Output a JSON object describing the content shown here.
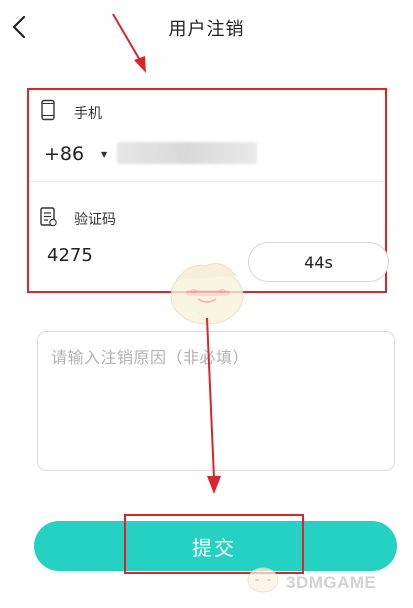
{
  "header": {
    "title": "用户注销",
    "back_icon": "chevron-left-icon"
  },
  "form": {
    "phone": {
      "icon": "phone-icon",
      "label": "手机",
      "country_code": "+86",
      "dropdown_icon": "caret-down-icon",
      "number_masked": true
    },
    "code": {
      "icon": "document-icon",
      "label": "验证码",
      "value": "4275",
      "countdown": "44s"
    }
  },
  "reason": {
    "placeholder": "请输入注销原因（非必填）"
  },
  "submit": {
    "label": "提交",
    "color": "#25d1c3"
  },
  "annotation": {
    "color": "#d9262d"
  },
  "watermark": {
    "text": "3DMGAME"
  }
}
